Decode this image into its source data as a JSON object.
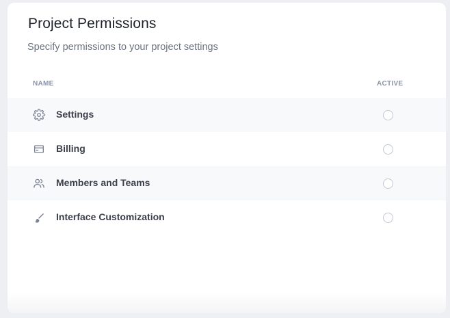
{
  "header": {
    "title": "Project Permissions",
    "subtitle": "Specify permissions to your project settings"
  },
  "table": {
    "columns": {
      "name": "NAME",
      "active": "ACTIVE"
    },
    "rows": [
      {
        "label": "Settings",
        "icon": "gear-icon",
        "active": false
      },
      {
        "label": "Billing",
        "icon": "card-icon",
        "active": false
      },
      {
        "label": "Members and Teams",
        "icon": "users-icon",
        "active": false
      },
      {
        "label": "Interface Customization",
        "icon": "brush-icon",
        "active": false
      }
    ]
  },
  "colors": {
    "icon": "#7b8294",
    "label": "#3a3f4a",
    "radio_border": "#c3c7cf",
    "row_shade": "#f8f9fb"
  }
}
